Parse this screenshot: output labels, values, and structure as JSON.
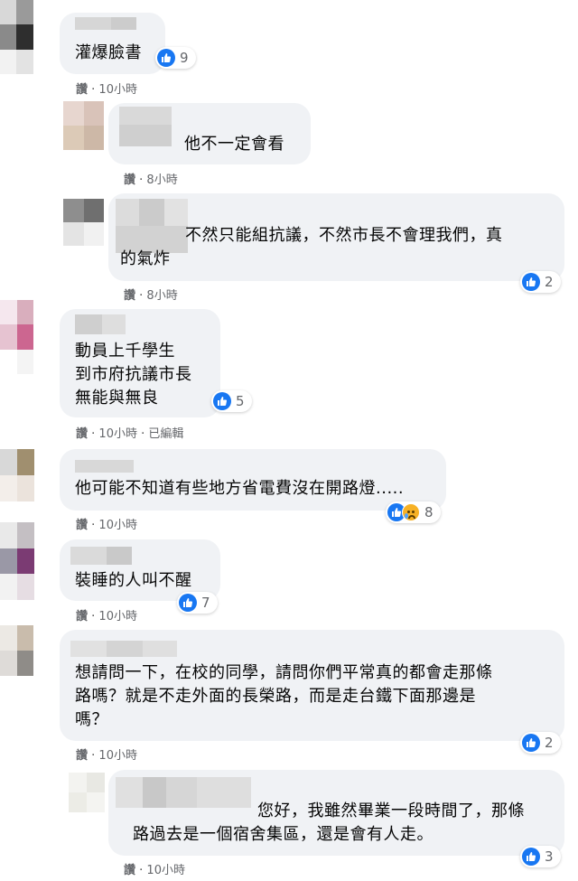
{
  "comments": [
    {
      "text": "灌爆臉書",
      "reactions": "9",
      "reply": "讚",
      "time": "10小時",
      "edited": ""
    },
    {
      "text": "他不一定會看",
      "reactions": "",
      "reply": "讚",
      "time": "8小時",
      "edited": ""
    },
    {
      "text": "不然只能組抗議，不然市長不會理我們，真\n的氣炸",
      "reactions": "2",
      "reply": "讚",
      "time": "8小時",
      "edited": ""
    },
    {
      "text": "動員上千學生\n到市府抗議市長\n無能與無良",
      "reactions": "5",
      "reply": "讚",
      "time": "10小時",
      "edited": "已編輯"
    },
    {
      "text": "他可能不知道有些地方省電費沒在開路燈.....",
      "reactions": "8",
      "reply": "讚",
      "time": "10小時",
      "edited": ""
    },
    {
      "text": "裝睡的人叫不醒",
      "reactions": "7",
      "reply": "讚",
      "time": "10小時",
      "edited": ""
    },
    {
      "text": "想請問一下，在校的同學，請問你們平常真的都會走那條\n路嗎？就是不走外面的長榮路，而是走台鐵下面那邊是\n嗎？",
      "reactions": "2",
      "reply": "讚",
      "time": "10小時",
      "edited": ""
    },
    {
      "text": "您好，我雖然畢業一段時間了，那條\n路過去是一個宿舍集區，還是會有人走。",
      "reactions": "3",
      "reply": "讚",
      "time": "10小時",
      "edited": ""
    }
  ],
  "separator": " · ",
  "icons": {
    "like": "like-icon",
    "sad": "sad-icon"
  },
  "colors": {
    "bubble": "#f0f2f5",
    "like": "#1877f2",
    "meta": "#65676b"
  }
}
